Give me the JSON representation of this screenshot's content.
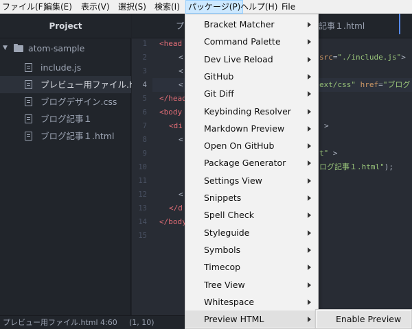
{
  "menubar": {
    "items": [
      "ファイル(F)",
      "編集(E)",
      "表示(V)",
      "選択(S)",
      "検索(I)",
      "パッケージ(P)",
      "ヘルプ(H)",
      "File"
    ]
  },
  "sidebar": {
    "title": "Project",
    "root": "atom-sample",
    "files": [
      "include.js",
      "プレビュー用ファイル.html",
      "ブログデザイン.css",
      "ブログ記事１",
      "ブログ記事１.html"
    ]
  },
  "tabs": {
    "left_fragment": "プ",
    "right_fragment": "記事１.html"
  },
  "editor": {
    "line_numbers": [
      "1",
      "2",
      "3",
      "4",
      "5",
      "6",
      "7",
      "8",
      "9",
      "10",
      "11",
      "12",
      "13",
      "14",
      "15"
    ],
    "current_line": "4",
    "frag": {
      "l1_tag": "<head",
      "l2_lt": "<",
      "l2_attr": "src",
      "l2_eq": "=",
      "l2_str": "\"./include.js\"",
      "l2_gt": ">",
      "l3_lt": "<",
      "l4_lt": "<",
      "l4_str1": "ext/css\"",
      "l4_attr": "href",
      "l4_eq": "=",
      "l4_str2": "\"ブログ",
      "l5_tag": "</head",
      "l6_tag": "<body",
      "l7_tag": "<di",
      "l7_gt": ">",
      "l8_lt": "<",
      "l9_str": "t\"",
      "l9_gt": ">",
      "l10_str": "ログ記事１.html\"",
      "l10_end": ");",
      "l12_lt": "<",
      "l13_tag": "</d",
      "l14_tag": "</body"
    }
  },
  "dropdown": {
    "items": [
      "Bracket Matcher",
      "Command Palette",
      "Dev Live Reload",
      "GitHub",
      "Git Diff",
      "Keybinding Resolver",
      "Markdown Preview",
      "Open On GitHub",
      "Package Generator",
      "Settings View",
      "Snippets",
      "Spell Check",
      "Styleguide",
      "Symbols",
      "Timecop",
      "Tree View",
      "Whitespace",
      "Preview HTML"
    ],
    "highlighted": "Preview HTML"
  },
  "submenu": {
    "items": [
      "Enable Preview"
    ]
  },
  "statusbar": {
    "file": "プレビュー用ファイル.html",
    "cursor": "4:60",
    "selection": "(1, 10)"
  },
  "colors": {
    "accent": "#568af2",
    "tag": "#e06c75",
    "attr": "#d19a66",
    "string": "#98c379"
  }
}
